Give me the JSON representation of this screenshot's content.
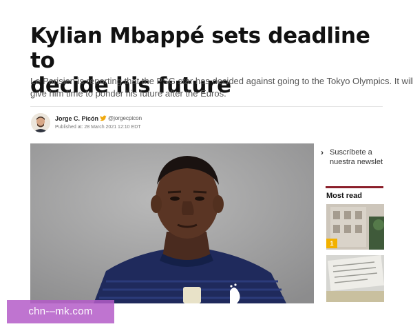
{
  "article": {
    "headline_lines": [
      "Kylian Mbappé sets deadline to",
      "decide his future"
    ],
    "subhead_lines": [
      "Le Parisien is reporting that the PSG star has decided against going to the Tokyo Olympics. It will",
      "give him time to ponder his future after the Euros."
    ],
    "author": {
      "name": "Jorge C. Picón",
      "handle": "@jorgecpicon",
      "handle_icon": "twitter-bird-icon",
      "published": "Published at: 28 March 2021 12:10 EDT"
    },
    "photo": {
      "subject": "footballer-in-france-jersey"
    }
  },
  "sidebar": {
    "newsletter_lines": [
      "Suscríbete a",
      "nuestra newslet"
    ],
    "newsletter_icon": "chevron-right-icon",
    "most_read_title": "Most read",
    "most_read_badge": "1",
    "accent_color": "#8b1f2a",
    "badge_color": "#f2b100"
  },
  "watermark": {
    "text": "chn-–mk.com",
    "color": "#b45cc8"
  }
}
